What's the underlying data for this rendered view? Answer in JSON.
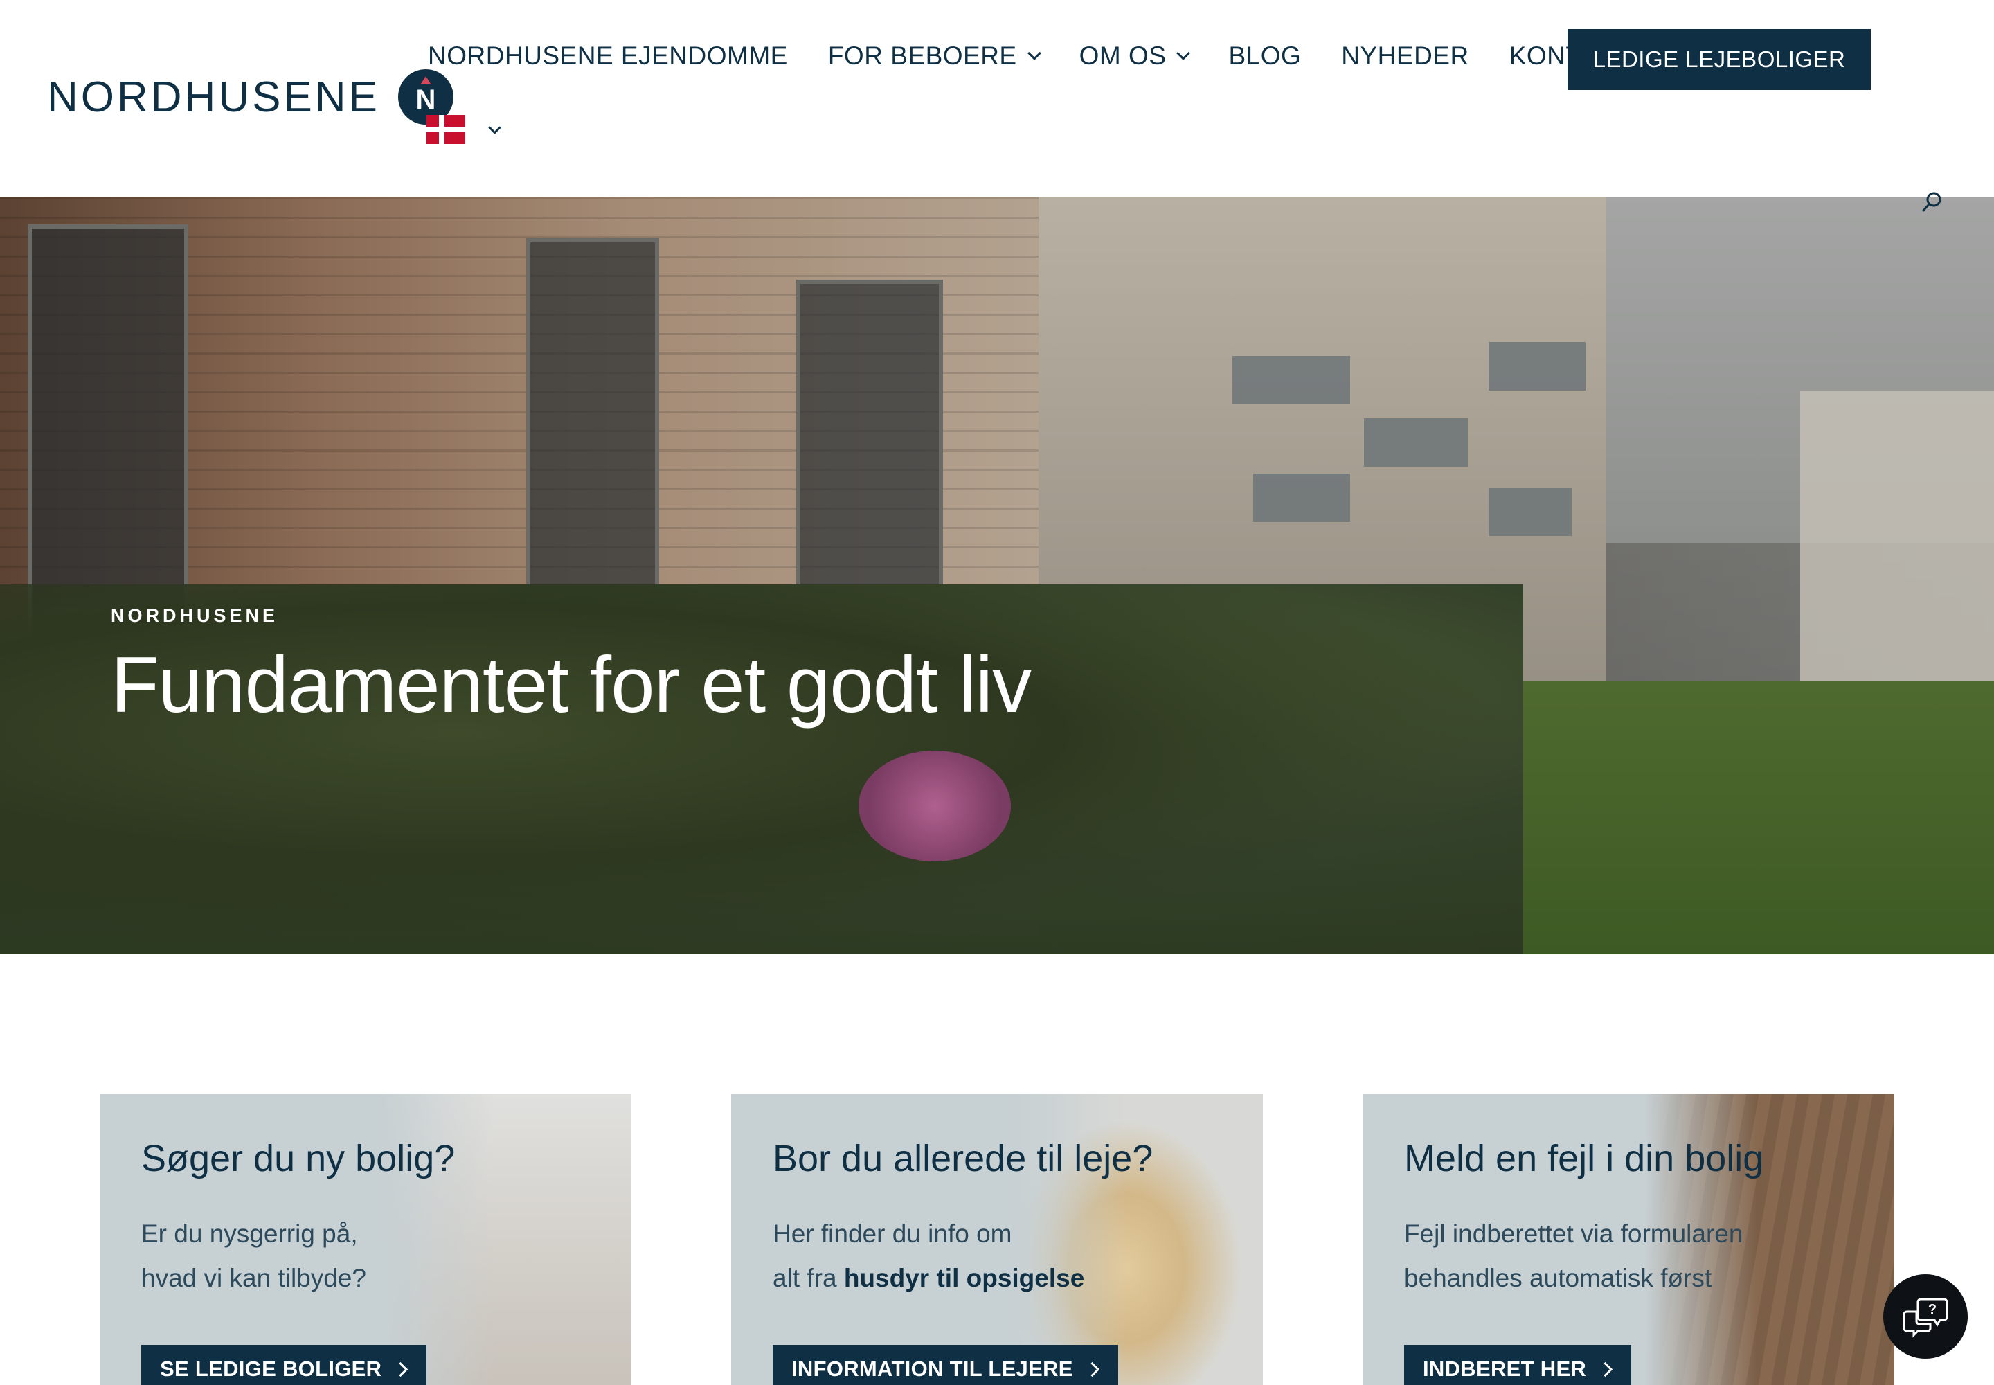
{
  "brand": {
    "name": "NORDHUSENE",
    "badge_letter": "N"
  },
  "nav": {
    "items": [
      {
        "label": "NORDHUSENE EJENDOMME",
        "has_dropdown": false
      },
      {
        "label": "FOR BEBOERE",
        "has_dropdown": true
      },
      {
        "label": "OM OS",
        "has_dropdown": true
      },
      {
        "label": "BLOG",
        "has_dropdown": false
      },
      {
        "label": "NYHEDER",
        "has_dropdown": false
      },
      {
        "label": "KONTAKT",
        "has_dropdown": false
      }
    ],
    "cta_label": "LEDIGE LEJEBOLIGER",
    "language": "Danish"
  },
  "hero": {
    "eyebrow": "NORDHUSENE",
    "title": "Fundamentet for et godt liv"
  },
  "cards": [
    {
      "title": "Søger du ny bolig?",
      "desc_line1": "Er du nysgerrig på,",
      "desc_line2": "hvad vi kan tilbyde?",
      "button": "SE LEDIGE BOLIGER"
    },
    {
      "title": "Bor du allerede til leje?",
      "desc_line1": "Her finder du info om",
      "desc_line2_prefix": "alt fra ",
      "desc_line2_bold": "husdyr til opsigelse",
      "button": "INFORMATION TIL LEJERE"
    },
    {
      "title": "Meld en fejl i din bolig",
      "desc_line1": "Fejl indberettet via formularen",
      "desc_line2": "behandles automatisk først",
      "button": "INDBERET HER"
    }
  ],
  "colors": {
    "primary": "#0e2f44",
    "accent": "#d9485a",
    "card_bg": "#c7d0d3"
  },
  "icons": [
    "search-icon",
    "chat-help-icon",
    "chevron-down-icon",
    "danish-flag-icon"
  ]
}
